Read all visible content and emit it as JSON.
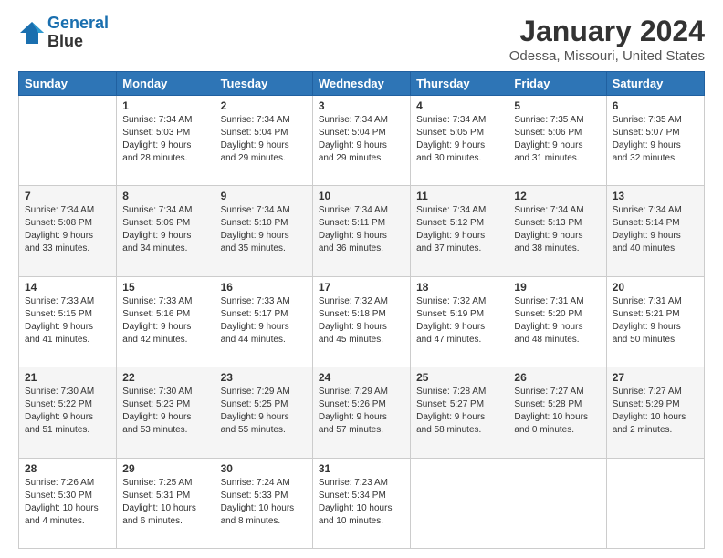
{
  "header": {
    "logo_line1": "General",
    "logo_line2": "Blue",
    "month": "January 2024",
    "location": "Odessa, Missouri, United States"
  },
  "days_of_week": [
    "Sunday",
    "Monday",
    "Tuesday",
    "Wednesday",
    "Thursday",
    "Friday",
    "Saturday"
  ],
  "weeks": [
    [
      {
        "day": "",
        "sunrise": "",
        "sunset": "",
        "daylight": ""
      },
      {
        "day": "1",
        "sunrise": "Sunrise: 7:34 AM",
        "sunset": "Sunset: 5:03 PM",
        "daylight": "Daylight: 9 hours and 28 minutes."
      },
      {
        "day": "2",
        "sunrise": "Sunrise: 7:34 AM",
        "sunset": "Sunset: 5:04 PM",
        "daylight": "Daylight: 9 hours and 29 minutes."
      },
      {
        "day": "3",
        "sunrise": "Sunrise: 7:34 AM",
        "sunset": "Sunset: 5:04 PM",
        "daylight": "Daylight: 9 hours and 29 minutes."
      },
      {
        "day": "4",
        "sunrise": "Sunrise: 7:34 AM",
        "sunset": "Sunset: 5:05 PM",
        "daylight": "Daylight: 9 hours and 30 minutes."
      },
      {
        "day": "5",
        "sunrise": "Sunrise: 7:35 AM",
        "sunset": "Sunset: 5:06 PM",
        "daylight": "Daylight: 9 hours and 31 minutes."
      },
      {
        "day": "6",
        "sunrise": "Sunrise: 7:35 AM",
        "sunset": "Sunset: 5:07 PM",
        "daylight": "Daylight: 9 hours and 32 minutes."
      }
    ],
    [
      {
        "day": "7",
        "sunrise": "Sunrise: 7:34 AM",
        "sunset": "Sunset: 5:08 PM",
        "daylight": "Daylight: 9 hours and 33 minutes."
      },
      {
        "day": "8",
        "sunrise": "Sunrise: 7:34 AM",
        "sunset": "Sunset: 5:09 PM",
        "daylight": "Daylight: 9 hours and 34 minutes."
      },
      {
        "day": "9",
        "sunrise": "Sunrise: 7:34 AM",
        "sunset": "Sunset: 5:10 PM",
        "daylight": "Daylight: 9 hours and 35 minutes."
      },
      {
        "day": "10",
        "sunrise": "Sunrise: 7:34 AM",
        "sunset": "Sunset: 5:11 PM",
        "daylight": "Daylight: 9 hours and 36 minutes."
      },
      {
        "day": "11",
        "sunrise": "Sunrise: 7:34 AM",
        "sunset": "Sunset: 5:12 PM",
        "daylight": "Daylight: 9 hours and 37 minutes."
      },
      {
        "day": "12",
        "sunrise": "Sunrise: 7:34 AM",
        "sunset": "Sunset: 5:13 PM",
        "daylight": "Daylight: 9 hours and 38 minutes."
      },
      {
        "day": "13",
        "sunrise": "Sunrise: 7:34 AM",
        "sunset": "Sunset: 5:14 PM",
        "daylight": "Daylight: 9 hours and 40 minutes."
      }
    ],
    [
      {
        "day": "14",
        "sunrise": "Sunrise: 7:33 AM",
        "sunset": "Sunset: 5:15 PM",
        "daylight": "Daylight: 9 hours and 41 minutes."
      },
      {
        "day": "15",
        "sunrise": "Sunrise: 7:33 AM",
        "sunset": "Sunset: 5:16 PM",
        "daylight": "Daylight: 9 hours and 42 minutes."
      },
      {
        "day": "16",
        "sunrise": "Sunrise: 7:33 AM",
        "sunset": "Sunset: 5:17 PM",
        "daylight": "Daylight: 9 hours and 44 minutes."
      },
      {
        "day": "17",
        "sunrise": "Sunrise: 7:32 AM",
        "sunset": "Sunset: 5:18 PM",
        "daylight": "Daylight: 9 hours and 45 minutes."
      },
      {
        "day": "18",
        "sunrise": "Sunrise: 7:32 AM",
        "sunset": "Sunset: 5:19 PM",
        "daylight": "Daylight: 9 hours and 47 minutes."
      },
      {
        "day": "19",
        "sunrise": "Sunrise: 7:31 AM",
        "sunset": "Sunset: 5:20 PM",
        "daylight": "Daylight: 9 hours and 48 minutes."
      },
      {
        "day": "20",
        "sunrise": "Sunrise: 7:31 AM",
        "sunset": "Sunset: 5:21 PM",
        "daylight": "Daylight: 9 hours and 50 minutes."
      }
    ],
    [
      {
        "day": "21",
        "sunrise": "Sunrise: 7:30 AM",
        "sunset": "Sunset: 5:22 PM",
        "daylight": "Daylight: 9 hours and 51 minutes."
      },
      {
        "day": "22",
        "sunrise": "Sunrise: 7:30 AM",
        "sunset": "Sunset: 5:23 PM",
        "daylight": "Daylight: 9 hours and 53 minutes."
      },
      {
        "day": "23",
        "sunrise": "Sunrise: 7:29 AM",
        "sunset": "Sunset: 5:25 PM",
        "daylight": "Daylight: 9 hours and 55 minutes."
      },
      {
        "day": "24",
        "sunrise": "Sunrise: 7:29 AM",
        "sunset": "Sunset: 5:26 PM",
        "daylight": "Daylight: 9 hours and 57 minutes."
      },
      {
        "day": "25",
        "sunrise": "Sunrise: 7:28 AM",
        "sunset": "Sunset: 5:27 PM",
        "daylight": "Daylight: 9 hours and 58 minutes."
      },
      {
        "day": "26",
        "sunrise": "Sunrise: 7:27 AM",
        "sunset": "Sunset: 5:28 PM",
        "daylight": "Daylight: 10 hours and 0 minutes."
      },
      {
        "day": "27",
        "sunrise": "Sunrise: 7:27 AM",
        "sunset": "Sunset: 5:29 PM",
        "daylight": "Daylight: 10 hours and 2 minutes."
      }
    ],
    [
      {
        "day": "28",
        "sunrise": "Sunrise: 7:26 AM",
        "sunset": "Sunset: 5:30 PM",
        "daylight": "Daylight: 10 hours and 4 minutes."
      },
      {
        "day": "29",
        "sunrise": "Sunrise: 7:25 AM",
        "sunset": "Sunset: 5:31 PM",
        "daylight": "Daylight: 10 hours and 6 minutes."
      },
      {
        "day": "30",
        "sunrise": "Sunrise: 7:24 AM",
        "sunset": "Sunset: 5:33 PM",
        "daylight": "Daylight: 10 hours and 8 minutes."
      },
      {
        "day": "31",
        "sunrise": "Sunrise: 7:23 AM",
        "sunset": "Sunset: 5:34 PM",
        "daylight": "Daylight: 10 hours and 10 minutes."
      },
      {
        "day": "",
        "sunrise": "",
        "sunset": "",
        "daylight": ""
      },
      {
        "day": "",
        "sunrise": "",
        "sunset": "",
        "daylight": ""
      },
      {
        "day": "",
        "sunrise": "",
        "sunset": "",
        "daylight": ""
      }
    ]
  ]
}
